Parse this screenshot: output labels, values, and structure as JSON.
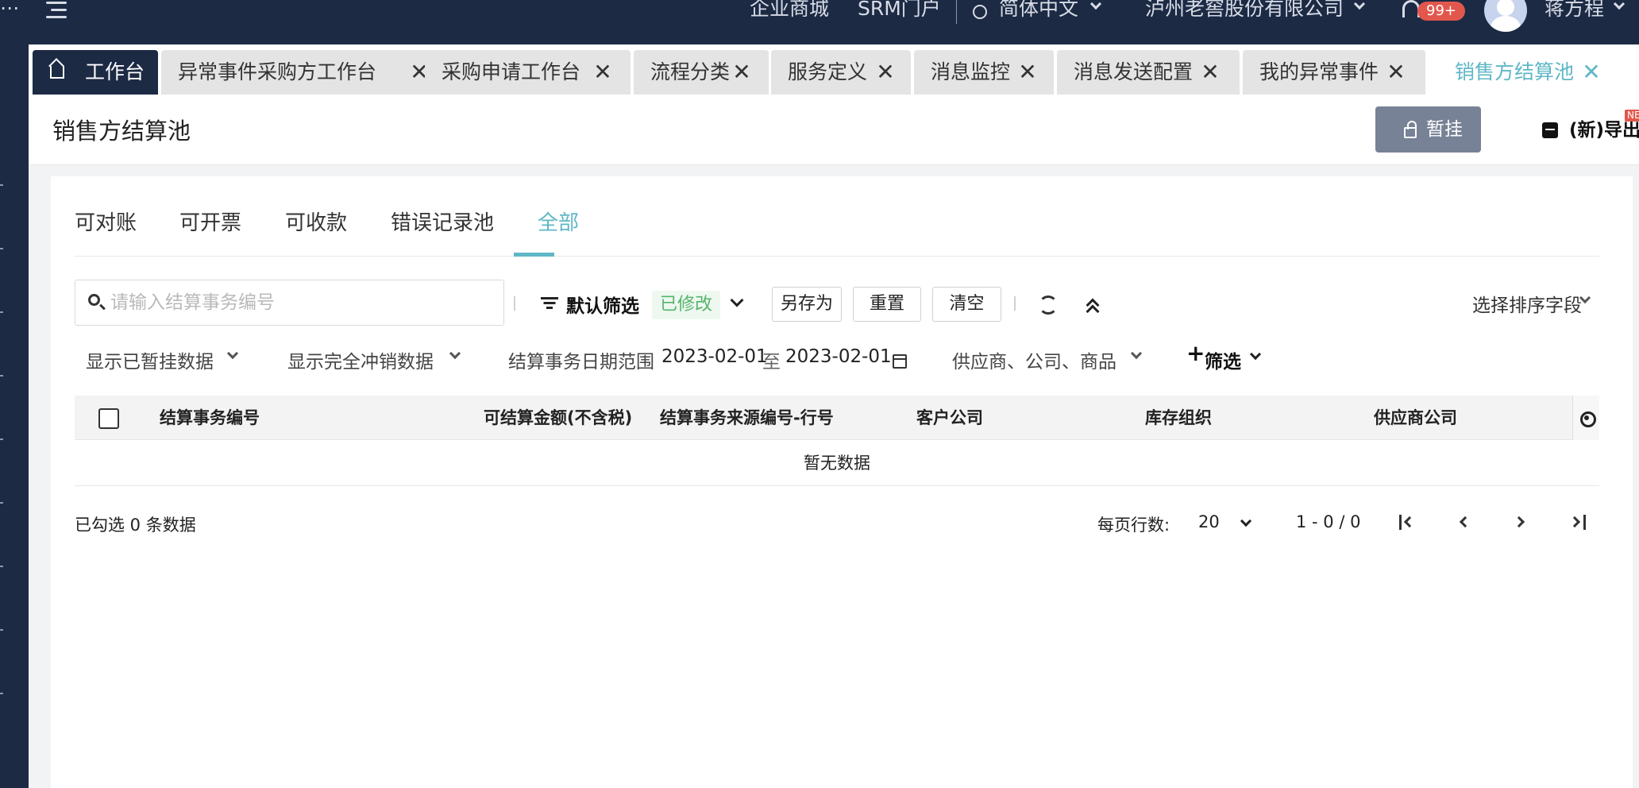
{
  "topbar": {
    "mall": "企业商城",
    "portal": "SRM门户",
    "language": "简体中文",
    "company": "泸州老窖股份有限公司",
    "notifications": "99+",
    "username": "蒋方程"
  },
  "tabs": [
    {
      "label": "工作台"
    },
    {
      "label": "异常事件采购方工作台"
    },
    {
      "label": "采购申请工作台"
    },
    {
      "label": "流程分类"
    },
    {
      "label": "服务定义"
    },
    {
      "label": "消息监控"
    },
    {
      "label": "消息发送配置"
    },
    {
      "label": "我的异常事件"
    },
    {
      "label": "销售方结算池"
    }
  ],
  "page": {
    "title": "销售方结算池",
    "hold_label": "暂挂",
    "export_label": "(新)导出",
    "new_tag": "NEW"
  },
  "subtabs": [
    "可对账",
    "可开票",
    "可收款",
    "错误记录池",
    "全部"
  ],
  "toolbar": {
    "search_placeholder": "请输入结算事务编号",
    "default_filter": "默认筛选",
    "modified_tag": "已修改",
    "save_as": "另存为",
    "reset": "重置",
    "clear": "清空",
    "sort_field": "选择排序字段"
  },
  "filters": {
    "show_held": "显示已暂挂数据",
    "show_offset": "显示完全冲销数据",
    "date_range_label": "结算事务日期范围",
    "date_from": "2023-02-01",
    "date_to_sep": "至",
    "date_to": "2023-02-01",
    "supplier_filter": "供应商、公司、商品",
    "more_filter": "筛选"
  },
  "table": {
    "columns": [
      "结算事务编号",
      "可结算金额(不含税)",
      "结算事务来源编号-行号",
      "客户公司",
      "库存组织",
      "供应商公司"
    ],
    "empty_text": "暂无数据"
  },
  "footer": {
    "selected": "已勾选 0 条数据",
    "rows_per_page_label": "每页行数:",
    "rows_per_page": "20",
    "range": "1 - 0 / 0"
  }
}
